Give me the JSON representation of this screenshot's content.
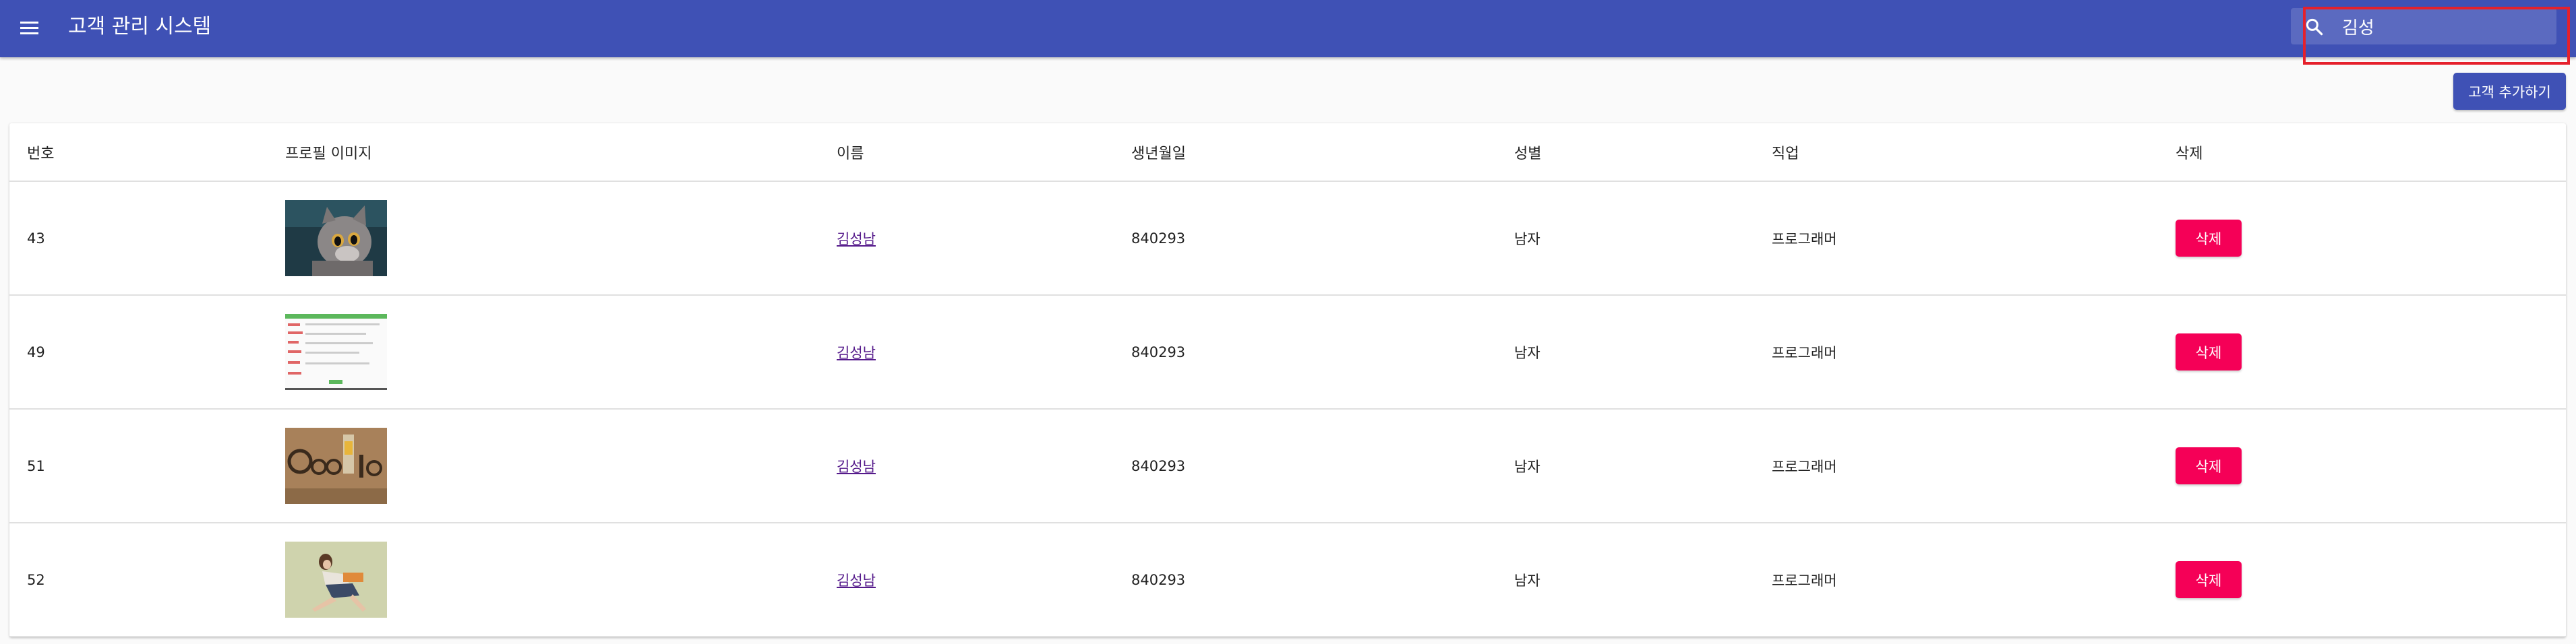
{
  "appbar": {
    "title": "고객 관리 시스템",
    "search_value": "김성",
    "colors": {
      "primary": "#3f51b5",
      "secondary": "#f50057"
    }
  },
  "actions": {
    "add_label": "고객 추가하기"
  },
  "table": {
    "headers": [
      "번호",
      "프로필 이미지",
      "이름",
      "생년월일",
      "성별",
      "직업",
      "삭제"
    ],
    "rows": [
      {
        "id": "43",
        "image": "cat-photo",
        "name": "김성남",
        "birthday": "840293",
        "gender": "남자",
        "job": "프로그래머",
        "delete_label": "삭제"
      },
      {
        "id": "49",
        "image": "webpage-screenshot",
        "name": "김성남",
        "birthday": "840293",
        "gender": "남자",
        "job": "프로그래머",
        "delete_label": "삭제"
      },
      {
        "id": "51",
        "image": "google-doodle",
        "name": "김성남",
        "birthday": "840293",
        "gender": "남자",
        "job": "프로그래머",
        "delete_label": "삭제"
      },
      {
        "id": "52",
        "image": "person-photo",
        "name": "김성남",
        "birthday": "840293",
        "gender": "남자",
        "job": "프로그래머",
        "delete_label": "삭제"
      }
    ]
  }
}
